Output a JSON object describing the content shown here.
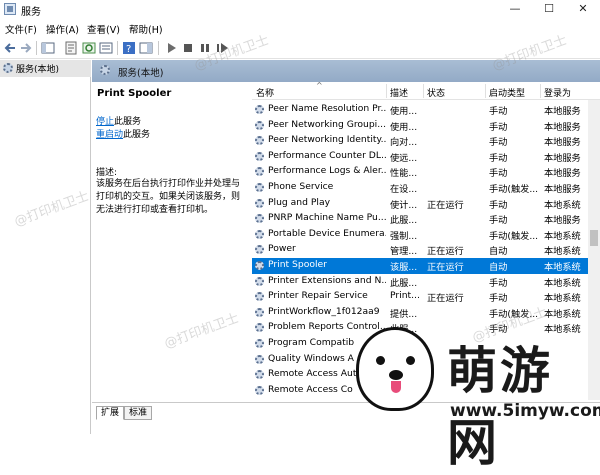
{
  "window": {
    "title": "服务",
    "controls": {
      "minimize": "—",
      "maximize": "☐",
      "close": "✕"
    }
  },
  "menu": [
    "文件(F)",
    "操作(A)",
    "查看(V)",
    "帮助(H)"
  ],
  "tree": {
    "label": "服务(本地)"
  },
  "panel_header": "服务(本地)",
  "detail": {
    "service_name": "Print Spooler",
    "stop_link": "停止",
    "stop_suffix": "此服务",
    "restart_link": "重启动",
    "restart_suffix": "此服务",
    "desc_label": "描述:",
    "desc_text": "该服务在后台执行打印作业并处理与打印机的交互。如果关闭该服务，则无法进行打印或查看打印机。"
  },
  "columns": {
    "name": "名称",
    "desc": "描述",
    "status": "状态",
    "startup": "启动类型",
    "logon": "登录为"
  },
  "rows": [
    {
      "name": "Peer Name Resolution Pr...",
      "desc": "使用...",
      "status": "",
      "startup": "手动",
      "logon": "本地服务"
    },
    {
      "name": "Peer Networking Groupi...",
      "desc": "使用...",
      "status": "",
      "startup": "手动",
      "logon": "本地服务"
    },
    {
      "name": "Peer Networking Identity...",
      "desc": "向对...",
      "status": "",
      "startup": "手动",
      "logon": "本地服务"
    },
    {
      "name": "Performance Counter DL...",
      "desc": "使远...",
      "status": "",
      "startup": "手动",
      "logon": "本地服务"
    },
    {
      "name": "Performance Logs & Aler...",
      "desc": "性能...",
      "status": "",
      "startup": "手动",
      "logon": "本地服务"
    },
    {
      "name": "Phone Service",
      "desc": "在设...",
      "status": "",
      "startup": "手动(触发...",
      "logon": "本地服务"
    },
    {
      "name": "Plug and Play",
      "desc": "使计...",
      "status": "正在运行",
      "startup": "手动",
      "logon": "本地系统"
    },
    {
      "name": "PNRP Machine Name Pu...",
      "desc": "此服...",
      "status": "",
      "startup": "手动",
      "logon": "本地服务"
    },
    {
      "name": "Portable Device Enumera...",
      "desc": "强制...",
      "status": "",
      "startup": "手动(触发...",
      "logon": "本地系统"
    },
    {
      "name": "Power",
      "desc": "管理...",
      "status": "正在运行",
      "startup": "自动",
      "logon": "本地系统"
    },
    {
      "name": "Print Spooler",
      "desc": "该服...",
      "status": "正在运行",
      "startup": "自动",
      "logon": "本地系统",
      "selected": true
    },
    {
      "name": "Printer Extensions and N...",
      "desc": "此服...",
      "status": "",
      "startup": "手动",
      "logon": "本地系统"
    },
    {
      "name": "Printer Repair Service",
      "desc": "Print...",
      "status": "正在运行",
      "startup": "手动",
      "logon": "本地系统"
    },
    {
      "name": "PrintWorkflow_1f012aa9",
      "desc": "提供...",
      "status": "",
      "startup": "手动(触发...",
      "logon": "本地系统"
    },
    {
      "name": "Problem Reports Control...",
      "desc": "此服...",
      "status": "",
      "startup": "手动",
      "logon": "本地系统"
    },
    {
      "name": "Program Compatib",
      "desc": "",
      "status": "",
      "startup": "",
      "logon": ""
    },
    {
      "name": "Quality Windows A",
      "desc": "",
      "status": "",
      "startup": "",
      "logon": ""
    },
    {
      "name": "Remote Access Aut",
      "desc": "",
      "status": "",
      "startup": "",
      "logon": ""
    },
    {
      "name": "Remote Access Co",
      "desc": "",
      "status": "",
      "startup": "",
      "logon": ""
    }
  ],
  "tabs": [
    "扩展",
    "标准"
  ],
  "watermarks": [
    "@打印机卫士",
    "@打印机卫士",
    "@打印机卫士",
    "@打印机卫士",
    "@打印机卫士"
  ],
  "logo": {
    "text": "萌游网",
    "url": "www.5imyw.com"
  },
  "colors": {
    "selection": "#0078d7",
    "header_band": "#9fb4ce",
    "link": "#0066cc"
  }
}
